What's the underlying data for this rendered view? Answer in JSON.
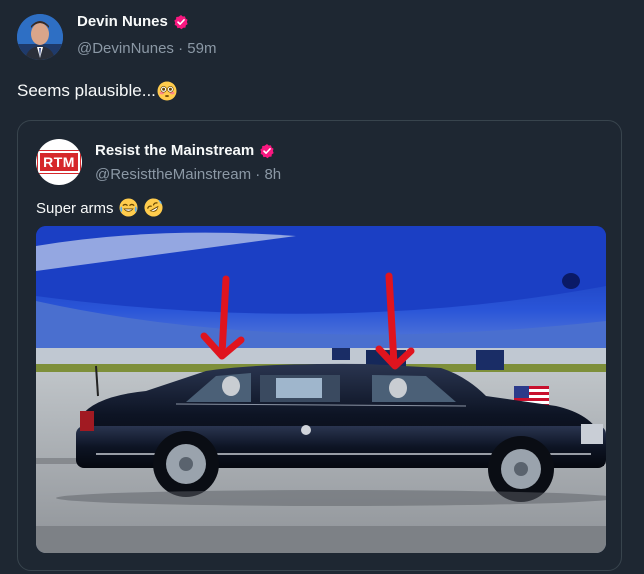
{
  "tweet": {
    "author_name": "Devin Nunes",
    "handle": "@DevinNunes",
    "separator": "·",
    "time": "59m",
    "text": "Seems plausible...",
    "text_emoji": "flushed-face-emoji",
    "verified_color": "#f91880"
  },
  "quoted_tweet": {
    "author_name": "Resist the Mainstream",
    "logo_text": "RTM",
    "handle": "@ResisttheMainstream",
    "separator": "·",
    "time": "8h",
    "text": "Super arms",
    "text_emojis": [
      "joy-emoji",
      "rofl-emoji"
    ],
    "media": "photo-black-limousine-with-red-arrows"
  },
  "colors": {
    "background": "#1e2732",
    "text": "#f7f9f9",
    "secondary_text": "#8b98a5",
    "border": "#38444d",
    "verified_badge": "#f91880"
  }
}
